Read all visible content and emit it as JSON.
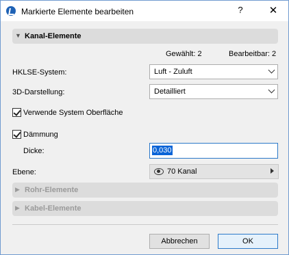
{
  "window": {
    "title": "Markierte Elemente bearbeiten",
    "help_label": "?",
    "close_label": "✕",
    "icon": "archicad-logo-icon"
  },
  "sections": {
    "kanal": {
      "label": "Kanal-Elemente",
      "expanded": true
    },
    "rohr": {
      "label": "Rohr-Elemente",
      "expanded": false
    },
    "kabel": {
      "label": "Kabel-Elemente",
      "expanded": false
    }
  },
  "counts": {
    "selected_label": "Gewählt: 2",
    "editable_label": "Bearbeitbar: 2"
  },
  "form": {
    "system_label": "HKLSE-System:",
    "system_value": "Luft - Zuluft",
    "display_label": "3D-Darstellung:",
    "display_value": "Detailliert",
    "use_surface_label": "Verwende System Oberfläche",
    "use_surface_checked": true,
    "insulation_label": "Dämmung",
    "insulation_checked": true,
    "thickness_label": "Dicke:",
    "thickness_value": "0,030",
    "layer_label": "Ebene:",
    "layer_value": "70 Kanal"
  },
  "buttons": {
    "cancel": "Abbrechen",
    "ok": "OK"
  }
}
